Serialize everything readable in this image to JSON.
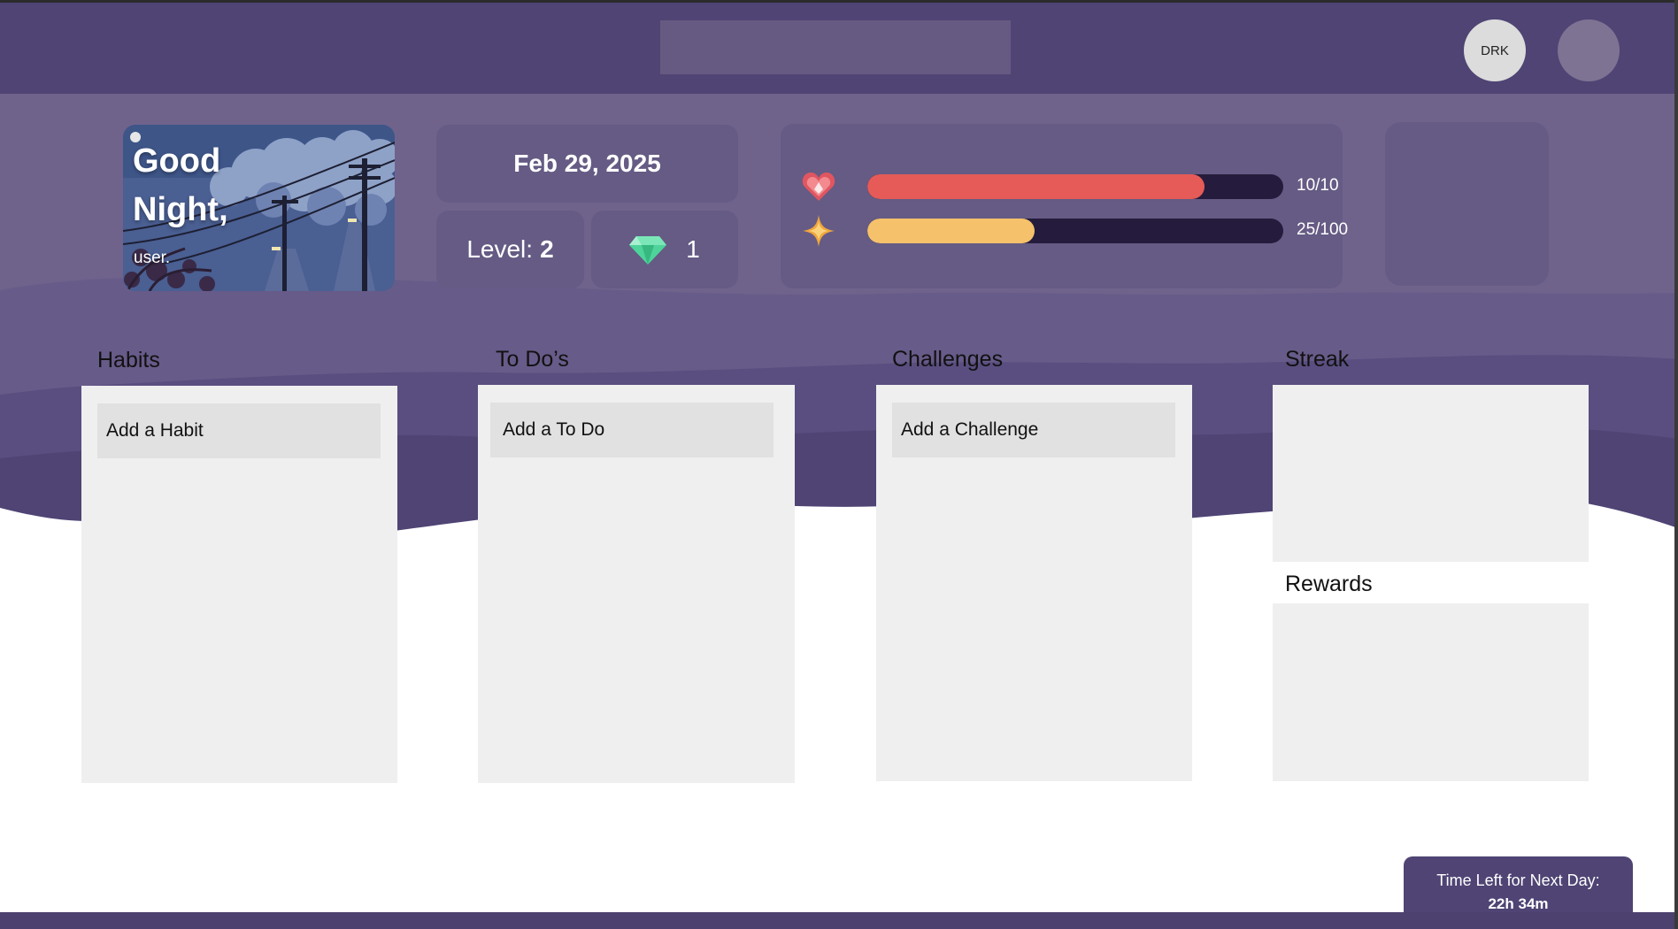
{
  "navbar": {
    "search_placeholder": "",
    "avatar_label": "DRK"
  },
  "greeting": {
    "title_line1": "Good",
    "title_line2": "Night,",
    "username": "user."
  },
  "date": "Feb 29, 2025",
  "level": {
    "label": "Level:",
    "value": "2"
  },
  "gems": {
    "icon": "gem-icon",
    "count": "1"
  },
  "stats": {
    "health": {
      "icon": "heart-icon",
      "current": 10,
      "max": 10,
      "fraction": 1.0,
      "text": "10/10",
      "color": "#e65b57"
    },
    "xp": {
      "icon": "star-icon",
      "current": 25,
      "max": 100,
      "fraction": 0.25,
      "text": "25/100",
      "color": "#f5c26b"
    }
  },
  "columns": {
    "habits": {
      "title": "Habits",
      "add_label": "Add a Habit"
    },
    "todos": {
      "title": "To Do’s",
      "add_label": "Add a To Do"
    },
    "challenges": {
      "title": "Challenges",
      "add_label": "Add a Challenge"
    },
    "streak": {
      "title": "Streak"
    },
    "rewards": {
      "title": "Rewards"
    }
  },
  "timer": {
    "label": "Time Left for Next Day:",
    "value": "22h 34m"
  },
  "colors": {
    "navbar": "#4f4474",
    "header_bg": "#6f638c",
    "card": "#655b84",
    "panel": "#efefef"
  }
}
